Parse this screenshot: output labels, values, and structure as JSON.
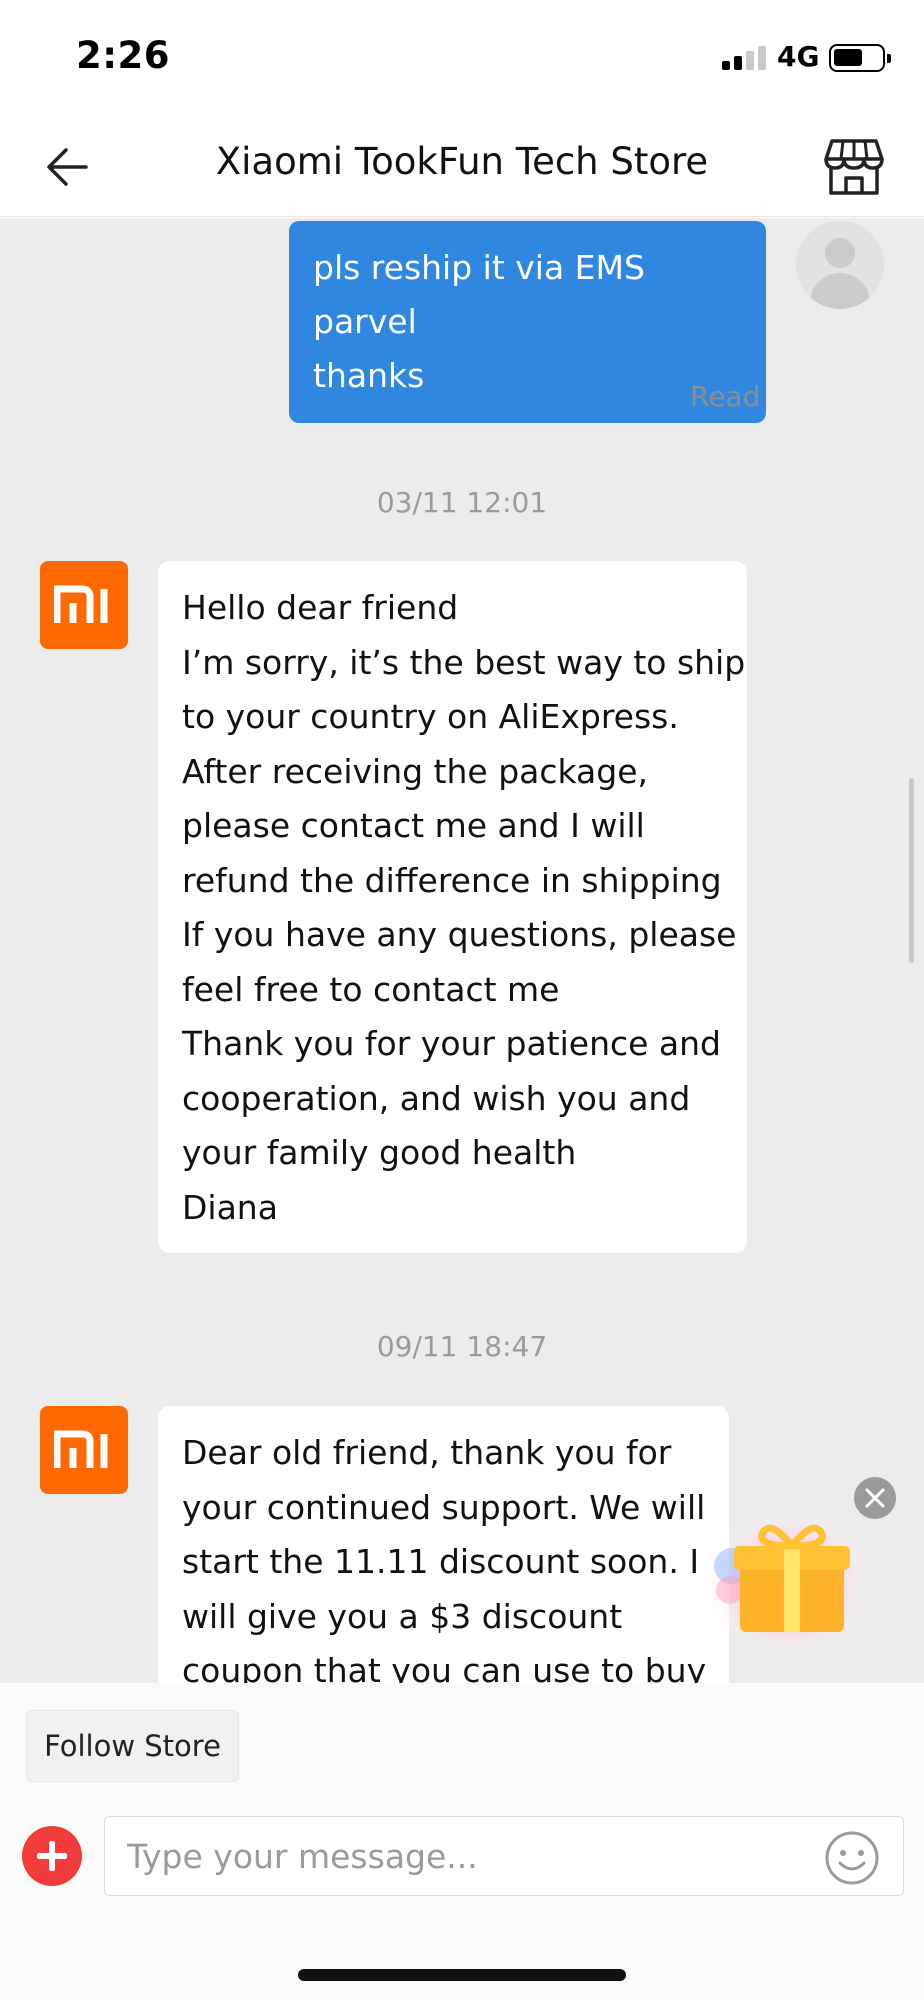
{
  "status_bar": {
    "time": "2:26",
    "network": "4G",
    "signal_bars": 2,
    "signal_bars_total": 4,
    "battery_level": 0.6
  },
  "header": {
    "title": "Xiaomi TookFun Tech Store",
    "back_icon": "arrow-left-icon",
    "store_icon": "storefront-icon"
  },
  "messages": {
    "outgoing": {
      "text": "pls reship it via EMS parvel thanks",
      "lines": [
        "pls reship it via EMS parvel",
        "thanks"
      ],
      "status": "Read"
    },
    "first_timestamp": "03/11 12:01",
    "first_reply": {
      "lines": [
        "Hello dear friend",
        "I’m sorry, it’s the best way to ship",
        "to your country on AliExpress.",
        "After receiving the package,",
        "please contact me and I will",
        "refund the difference in shipping",
        "If you have any questions, please",
        "feel free to contact me",
        "Thank you for your patience and",
        "cooperation, and wish you and",
        "your family good health",
        "Diana"
      ]
    },
    "second_timestamp": "09/11 18:47",
    "second_reply": {
      "lines": [
        "Dear old friend, thank you for",
        "your continued support. We will",
        "start the 11.11 discount soon. I",
        "will give you a $3 discount",
        "coupon that you can use to buy"
      ]
    }
  },
  "composer": {
    "follow_label": "Follow Store",
    "placeholder": "Type your message...",
    "add_icon": "plus-circle-icon",
    "emoji_icon": "smiley-icon"
  },
  "colors": {
    "outgoing_bubble": "#2f87e0",
    "brand_orange": "#ff6900",
    "add_button": "#f23c3c",
    "chat_background": "#ececec"
  }
}
